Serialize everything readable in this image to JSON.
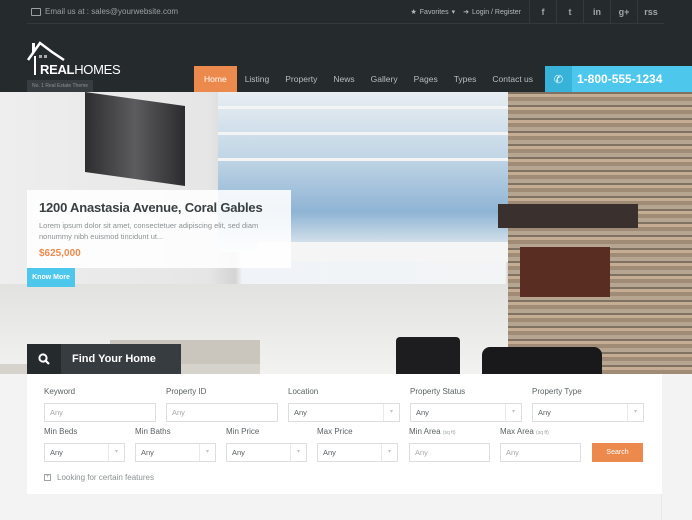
{
  "topbar": {
    "email_text": "Email us at : sales@yourwebsite.com",
    "favorites_label": "Favorites",
    "login_label": "Login / Register",
    "social_icons": [
      "facebook-icon",
      "twitter-icon",
      "linkedin-icon",
      "google-plus-icon",
      "rss-icon"
    ],
    "social_glyphs": [
      "f",
      "t",
      "in",
      "g+",
      "rss"
    ]
  },
  "brand": {
    "name_bold": "REAL",
    "name_light": "HOMES",
    "tagline": "No. 1 Real Estate Theme"
  },
  "nav": {
    "items": [
      "Home",
      "Listing",
      "Property",
      "News",
      "Gallery",
      "Pages",
      "Types",
      "Contact us"
    ],
    "active": "Home"
  },
  "phone": {
    "number": "1-800-555-1234"
  },
  "slide": {
    "title": "1200 Anastasia Avenue, Coral Gables",
    "description": "Lorem ipsum dolor sit amet, consectetuer adipiscing elit, sed diam nonummy nibh euismod tincidunt ut...",
    "price": "$625,000",
    "button": "Know More"
  },
  "search": {
    "heading": "Find Your Home",
    "fields": {
      "keyword": {
        "label": "Keyword",
        "placeholder": "Any"
      },
      "property_id": {
        "label": "Property ID",
        "placeholder": "Any"
      },
      "location": {
        "label": "Location",
        "value": "Any"
      },
      "property_status": {
        "label": "Property Status",
        "value": "Any"
      },
      "property_type": {
        "label": "Property Type",
        "value": "Any"
      },
      "min_beds": {
        "label": "Min Beds",
        "value": "Any"
      },
      "min_baths": {
        "label": "Min Baths",
        "value": "Any"
      },
      "min_price": {
        "label": "Min Price",
        "value": "Any"
      },
      "max_price": {
        "label": "Max Price",
        "value": "Any"
      },
      "min_area": {
        "label": "Min Area",
        "unit": "(sq ft)",
        "placeholder": "Any"
      },
      "max_area": {
        "label": "Max Area",
        "unit": "(sq ft)",
        "placeholder": "Any"
      }
    },
    "submit": "Search",
    "features_toggle": "Looking for certain features"
  },
  "colors": {
    "accent_orange": "#ec894d",
    "accent_blue": "#4dc7ec",
    "header_dark": "#252a2d"
  }
}
